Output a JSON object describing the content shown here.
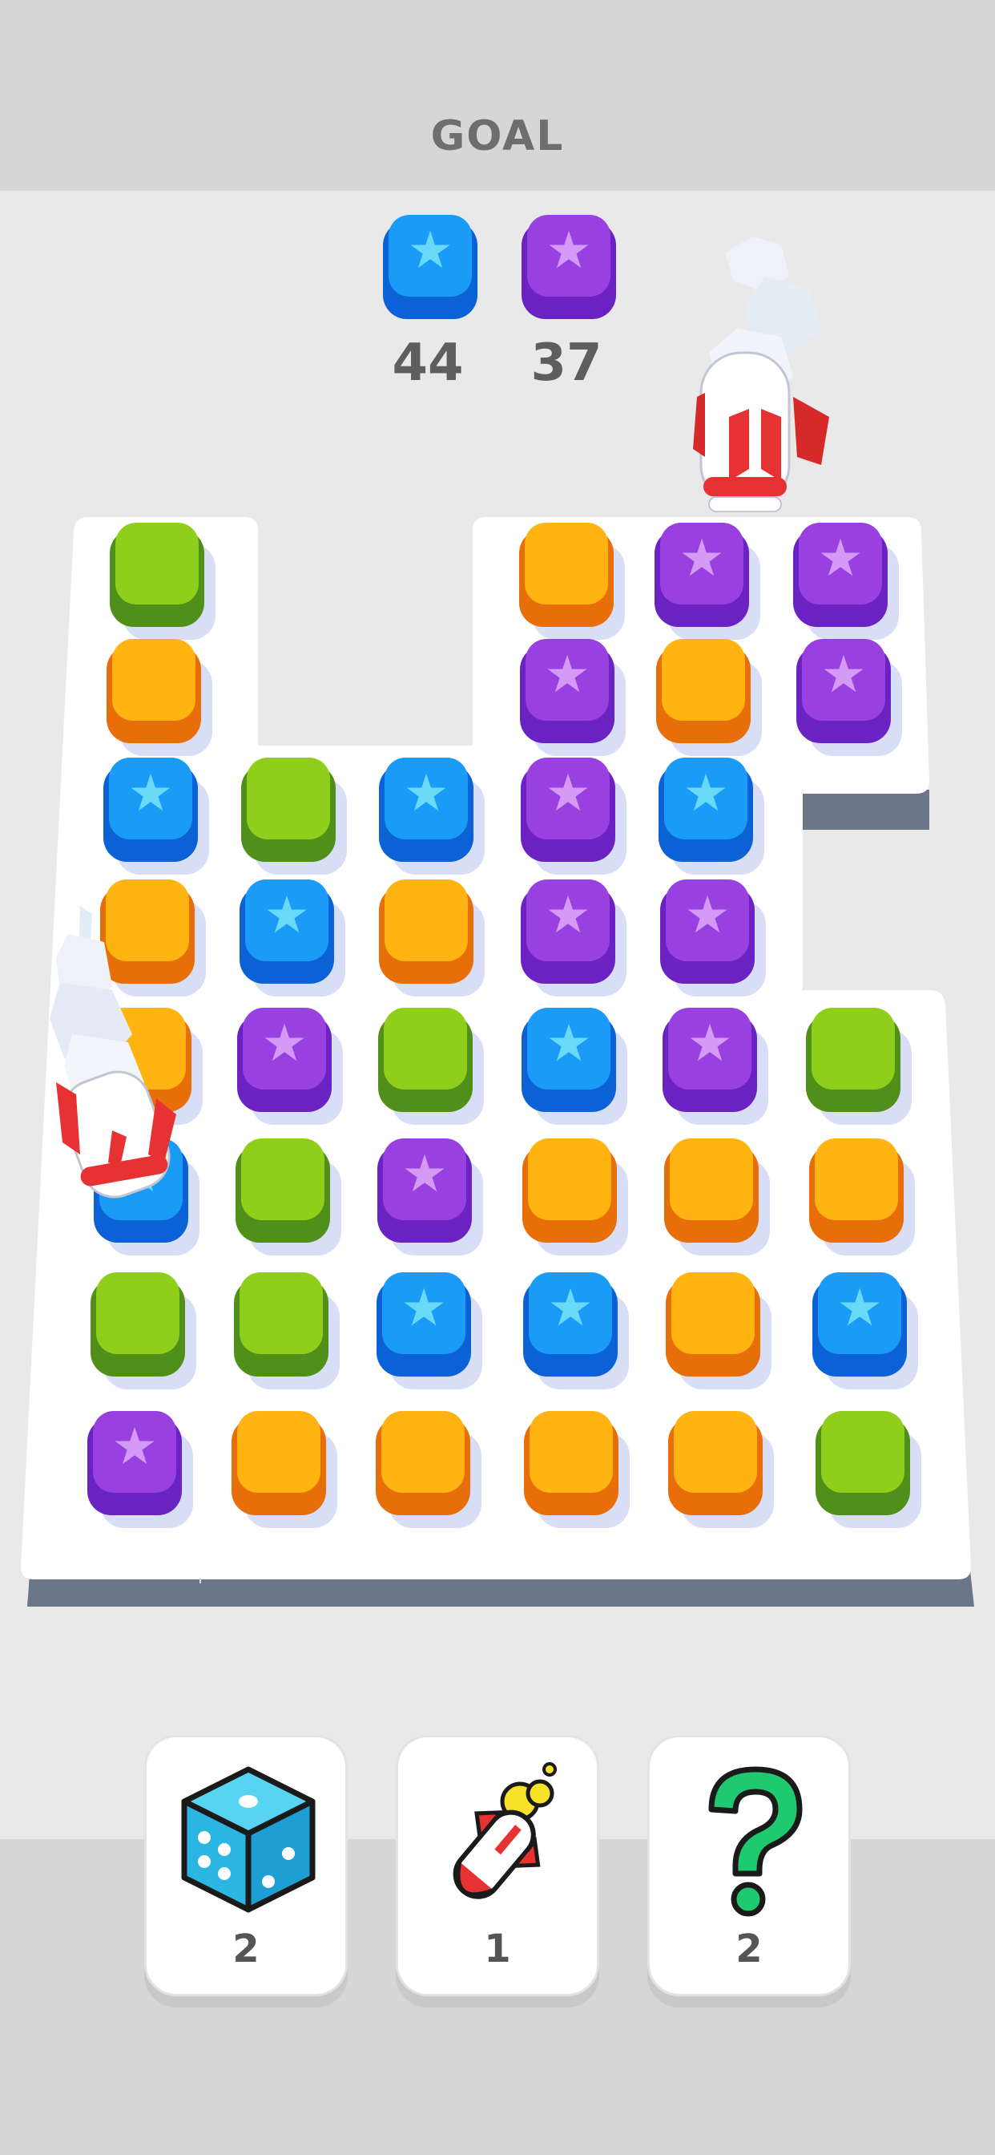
{
  "header": {
    "title": "GOAL"
  },
  "goals": [
    {
      "color": "blue",
      "count": "44"
    },
    {
      "color": "purple",
      "count": "37"
    }
  ],
  "tile_colors": {
    "green": "#8fcf1c",
    "orange": "#ffb411",
    "blue": "#1a9bf5",
    "purple": "#9840e0"
  },
  "board": {
    "rows": [
      [
        "green",
        null,
        null,
        "orange",
        "purple",
        "purple"
      ],
      [
        "orange",
        null,
        null,
        "purple",
        "orange",
        "purple"
      ],
      [
        "blue",
        "green",
        "blue",
        "purple",
        "blue",
        null
      ],
      [
        "orange",
        "blue",
        "orange",
        "purple",
        "purple",
        null
      ],
      [
        "orange",
        "purple",
        "green",
        "blue",
        "purple",
        "green"
      ],
      [
        "blue",
        "green",
        "purple",
        "orange",
        "orange",
        "orange"
      ],
      [
        "green",
        "green",
        "blue",
        "blue",
        "orange",
        "blue"
      ],
      [
        "purple",
        "orange",
        "orange",
        "orange",
        "orange",
        "green"
      ]
    ],
    "rockets": [
      "rocket-top-right",
      "rocket-left"
    ]
  },
  "boosters": [
    {
      "icon": "dice-icon",
      "count": "2"
    },
    {
      "icon": "rocket-icon",
      "count": "1"
    },
    {
      "icon": "question-icon",
      "count": "2"
    }
  ]
}
